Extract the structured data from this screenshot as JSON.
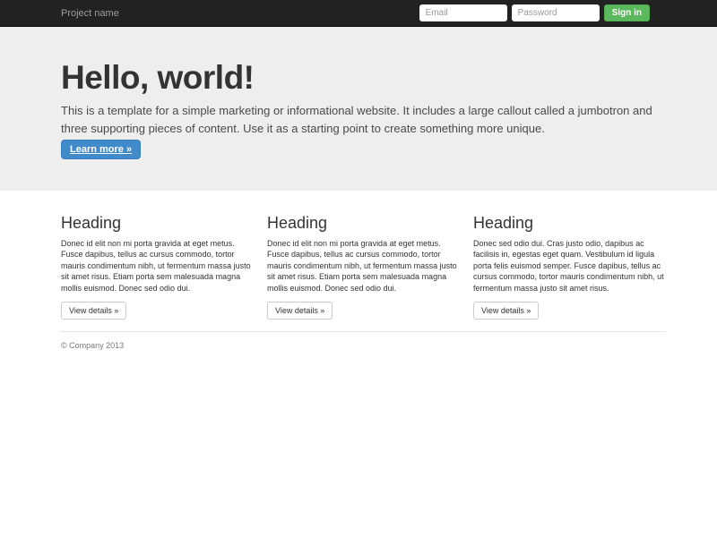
{
  "navbar": {
    "brand": "Project name",
    "email_placeholder": "Email",
    "password_placeholder": "Password",
    "sign_in_label": "Sign in"
  },
  "jumbotron": {
    "title": "Hello, world!",
    "description": "This is a template for a simple marketing or informational website. It includes a large callout called a jumbotron and three supporting pieces of content. Use it as a starting point to create something more unique.",
    "cta_label": "Learn more »"
  },
  "columns": [
    {
      "heading": "Heading",
      "text": "Donec id elit non mi porta gravida at eget metus. Fusce dapibus, tellus ac cursus commodo, tortor mauris condimentum nibh, ut fermentum massa justo sit amet risus. Etiam porta sem malesuada magna mollis euismod. Donec sed odio dui.",
      "button_label": "View details »"
    },
    {
      "heading": "Heading",
      "text": "Donec id elit non mi porta gravida at eget metus. Fusce dapibus, tellus ac cursus commodo, tortor mauris condimentum nibh, ut fermentum massa justo sit amet risus. Etiam porta sem malesuada magna mollis euismod. Donec sed odio dui.",
      "button_label": "View details »"
    },
    {
      "heading": "Heading",
      "text": "Donec sed odio dui. Cras justo odio, dapibus ac facilisis in, egestas eget quam. Vestibulum id ligula porta felis euismod semper. Fusce dapibus, tellus ac cursus commodo, tortor mauris condimentum nibh, ut fermentum massa justo sit amet risus.",
      "button_label": "View details »"
    }
  ],
  "footer": {
    "copyright": "© Company 2013"
  },
  "colors": {
    "navbar_bg": "#222222",
    "jumbotron_bg": "#eeeeee",
    "primary": "#428bca",
    "success": "#5cb85c"
  }
}
